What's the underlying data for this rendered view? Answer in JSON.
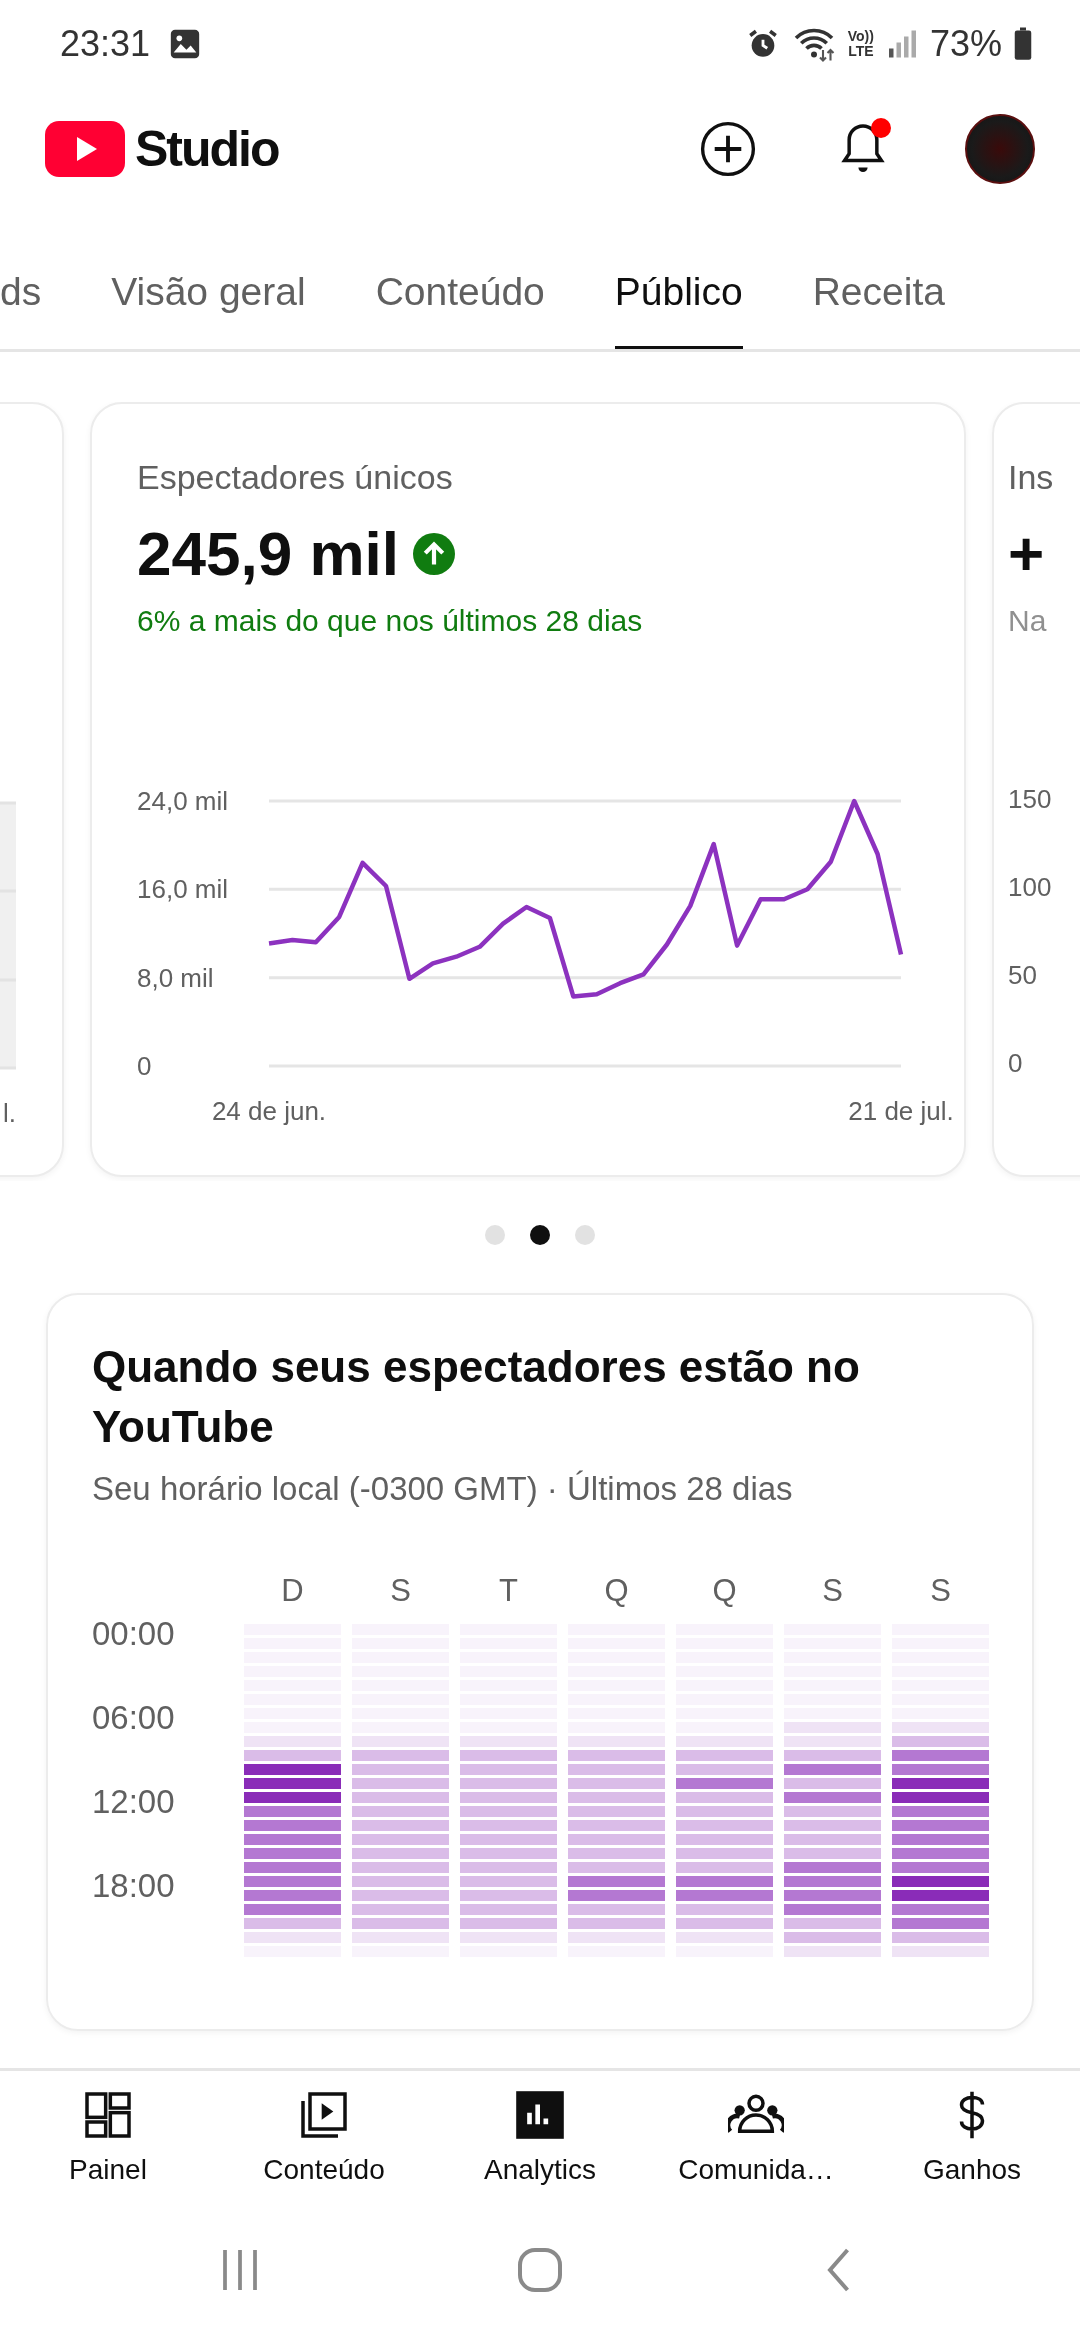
{
  "status_bar": {
    "time": "23:31",
    "network_label": [
      "Vo))",
      "LTE"
    ],
    "battery": "73%"
  },
  "header": {
    "title": "Studio",
    "notification_badge": true
  },
  "tabs": [
    {
      "label": "ds",
      "selected": false
    },
    {
      "label": "Visão geral",
      "selected": false
    },
    {
      "label": "Conteúdo",
      "selected": false
    },
    {
      "label": "Público",
      "selected": true
    },
    {
      "label": "Receita",
      "selected": false
    }
  ],
  "cards": [
    {
      "kind": "partial_left",
      "x_label": "l."
    },
    {
      "kind": "metric",
      "title": "Espectadores únicos",
      "value": "245,9 mil",
      "rising": true,
      "change": "6% a mais do que nos últimos 28 dias",
      "chart_data": {
        "type": "line",
        "ylim": [
          0,
          24
        ],
        "yticks": [
          {
            "value": 0,
            "label": "0"
          },
          {
            "value": 8,
            "label": "8,0 mil"
          },
          {
            "value": 16,
            "label": "16,0 mil"
          },
          {
            "value": 24,
            "label": "24,0 mil"
          }
        ],
        "categories": [
          "24 de jun.",
          null,
          null,
          null,
          null,
          null,
          null,
          null,
          null,
          null,
          null,
          null,
          null,
          null,
          null,
          null,
          null,
          null,
          null,
          null,
          null,
          null,
          null,
          null,
          null,
          null,
          null,
          "21 de jul."
        ],
        "series": [
          {
            "color": "#8c32bf",
            "values": [
              11.1,
              11.4,
              11.2,
              13.5,
              18.4,
              16.3,
              7.9,
              9.3,
              9.9,
              10.8,
              12.9,
              14.4,
              13.4,
              6.3,
              6.5,
              7.5,
              8.3,
              11.0,
              14.5,
              20.1,
              10.9,
              15.1,
              15.1,
              16.0,
              18.5,
              24.0,
              19.2,
              10.1
            ]
          }
        ]
      }
    },
    {
      "kind": "partial_right",
      "title": "Ins",
      "value": "+",
      "subtitle": "Na",
      "yticks": [
        "150",
        "100",
        "50",
        "0"
      ]
    }
  ],
  "pages": [
    {
      "selected": false
    },
    {
      "selected": true
    },
    {
      "selected": false
    }
  ],
  "heatmap_card": {
    "title": "Quando seus espectadores estão no YouTube",
    "subtitle": "Seu horário local (-0300 GMT) · Últimos 28 dias",
    "hour_labels": [
      "00:00",
      "06:00",
      "12:00",
      "18:00"
    ],
    "days": [
      {
        "label": "D",
        "hours": [
          {
            "color": "#f8f3fb"
          },
          {
            "color": "#f8f3fb"
          },
          {
            "color": "#f8f3fb"
          },
          {
            "color": "#f8f3fb"
          },
          {
            "color": "#f8f3fb"
          },
          {
            "color": "#f8f3fb"
          },
          {
            "color": "#f8f3fb"
          },
          {
            "color": "#f8f3fb"
          },
          {
            "color": "#efe3f5"
          },
          {
            "color": "#dabce8"
          },
          {
            "color": "#8a2cb8"
          },
          {
            "color": "#8a2cb8"
          },
          {
            "color": "#8a2cb8"
          },
          {
            "color": "#b478d2"
          },
          {
            "color": "#b478d2"
          },
          {
            "color": "#b478d2"
          },
          {
            "color": "#b478d2"
          },
          {
            "color": "#b478d2"
          },
          {
            "color": "#b478d2"
          },
          {
            "color": "#b478d2"
          },
          {
            "color": "#b478d2"
          },
          {
            "color": "#dabce8"
          },
          {
            "color": "#efe3f5"
          },
          {
            "color": "#f8f3fb"
          }
        ]
      },
      {
        "label": "S",
        "hours": [
          {
            "color": "#f8f3fb"
          },
          {
            "color": "#f8f3fb"
          },
          {
            "color": "#f8f3fb"
          },
          {
            "color": "#f8f3fb"
          },
          {
            "color": "#f8f3fb"
          },
          {
            "color": "#f8f3fb"
          },
          {
            "color": "#f8f3fb"
          },
          {
            "color": "#f8f3fb"
          },
          {
            "color": "#efe3f5"
          },
          {
            "color": "#dabce8"
          },
          {
            "color": "#dabce8"
          },
          {
            "color": "#dabce8"
          },
          {
            "color": "#dabce8"
          },
          {
            "color": "#dabce8"
          },
          {
            "color": "#dabce8"
          },
          {
            "color": "#dabce8"
          },
          {
            "color": "#dabce8"
          },
          {
            "color": "#dabce8"
          },
          {
            "color": "#dabce8"
          },
          {
            "color": "#dabce8"
          },
          {
            "color": "#dabce8"
          },
          {
            "color": "#dabce8"
          },
          {
            "color": "#efe3f5"
          },
          {
            "color": "#f8f3fb"
          }
        ]
      },
      {
        "label": "T",
        "hours": [
          {
            "color": "#f8f3fb"
          },
          {
            "color": "#f8f3fb"
          },
          {
            "color": "#f8f3fb"
          },
          {
            "color": "#f8f3fb"
          },
          {
            "color": "#f8f3fb"
          },
          {
            "color": "#f8f3fb"
          },
          {
            "color": "#f8f3fb"
          },
          {
            "color": "#f8f3fb"
          },
          {
            "color": "#efe3f5"
          },
          {
            "color": "#dabce8"
          },
          {
            "color": "#dabce8"
          },
          {
            "color": "#dabce8"
          },
          {
            "color": "#dabce8"
          },
          {
            "color": "#dabce8"
          },
          {
            "color": "#dabce8"
          },
          {
            "color": "#dabce8"
          },
          {
            "color": "#dabce8"
          },
          {
            "color": "#dabce8"
          },
          {
            "color": "#dabce8"
          },
          {
            "color": "#dabce8"
          },
          {
            "color": "#dabce8"
          },
          {
            "color": "#dabce8"
          },
          {
            "color": "#efe3f5"
          },
          {
            "color": "#f8f3fb"
          }
        ]
      },
      {
        "label": "Q",
        "hours": [
          {
            "color": "#f8f3fb"
          },
          {
            "color": "#f8f3fb"
          },
          {
            "color": "#f8f3fb"
          },
          {
            "color": "#f8f3fb"
          },
          {
            "color": "#f8f3fb"
          },
          {
            "color": "#f8f3fb"
          },
          {
            "color": "#f8f3fb"
          },
          {
            "color": "#f8f3fb"
          },
          {
            "color": "#efe3f5"
          },
          {
            "color": "#dabce8"
          },
          {
            "color": "#dabce8"
          },
          {
            "color": "#dabce8"
          },
          {
            "color": "#dabce8"
          },
          {
            "color": "#dabce8"
          },
          {
            "color": "#dabce8"
          },
          {
            "color": "#dabce8"
          },
          {
            "color": "#dabce8"
          },
          {
            "color": "#dabce8"
          },
          {
            "color": "#b478d2"
          },
          {
            "color": "#b478d2"
          },
          {
            "color": "#dabce8"
          },
          {
            "color": "#dabce8"
          },
          {
            "color": "#efe3f5"
          },
          {
            "color": "#f8f3fb"
          }
        ]
      },
      {
        "label": "Q",
        "hours": [
          {
            "color": "#f8f3fb"
          },
          {
            "color": "#f8f3fb"
          },
          {
            "color": "#f8f3fb"
          },
          {
            "color": "#f8f3fb"
          },
          {
            "color": "#f8f3fb"
          },
          {
            "color": "#f8f3fb"
          },
          {
            "color": "#f8f3fb"
          },
          {
            "color": "#f8f3fb"
          },
          {
            "color": "#efe3f5"
          },
          {
            "color": "#dabce8"
          },
          {
            "color": "#dabce8"
          },
          {
            "color": "#b478d2"
          },
          {
            "color": "#dabce8"
          },
          {
            "color": "#dabce8"
          },
          {
            "color": "#dabce8"
          },
          {
            "color": "#dabce8"
          },
          {
            "color": "#dabce8"
          },
          {
            "color": "#dabce8"
          },
          {
            "color": "#b478d2"
          },
          {
            "color": "#b478d2"
          },
          {
            "color": "#dabce8"
          },
          {
            "color": "#dabce8"
          },
          {
            "color": "#efe3f5"
          },
          {
            "color": "#f8f3fb"
          }
        ]
      },
      {
        "label": "S",
        "hours": [
          {
            "color": "#f8f3fb"
          },
          {
            "color": "#f8f3fb"
          },
          {
            "color": "#f8f3fb"
          },
          {
            "color": "#f8f3fb"
          },
          {
            "color": "#f8f3fb"
          },
          {
            "color": "#f8f3fb"
          },
          {
            "color": "#f8f3fb"
          },
          {
            "color": "#efe3f5"
          },
          {
            "color": "#efe3f5"
          },
          {
            "color": "#dabce8"
          },
          {
            "color": "#b478d2"
          },
          {
            "color": "#dabce8"
          },
          {
            "color": "#b478d2"
          },
          {
            "color": "#dabce8"
          },
          {
            "color": "#dabce8"
          },
          {
            "color": "#dabce8"
          },
          {
            "color": "#dabce8"
          },
          {
            "color": "#b478d2"
          },
          {
            "color": "#b478d2"
          },
          {
            "color": "#b478d2"
          },
          {
            "color": "#b478d2"
          },
          {
            "color": "#dabce8"
          },
          {
            "color": "#dabce8"
          },
          {
            "color": "#efe3f5"
          }
        ]
      },
      {
        "label": "S",
        "hours": [
          {
            "color": "#f8f3fb"
          },
          {
            "color": "#f8f3fb"
          },
          {
            "color": "#f8f3fb"
          },
          {
            "color": "#f8f3fb"
          },
          {
            "color": "#f8f3fb"
          },
          {
            "color": "#f8f3fb"
          },
          {
            "color": "#f8f3fb"
          },
          {
            "color": "#efe3f5"
          },
          {
            "color": "#dabce8"
          },
          {
            "color": "#b478d2"
          },
          {
            "color": "#b478d2"
          },
          {
            "color": "#8a2cb8"
          },
          {
            "color": "#8a2cb8"
          },
          {
            "color": "#b478d2"
          },
          {
            "color": "#b478d2"
          },
          {
            "color": "#b478d2"
          },
          {
            "color": "#b478d2"
          },
          {
            "color": "#b478d2"
          },
          {
            "color": "#8a2cb8"
          },
          {
            "color": "#8a2cb8"
          },
          {
            "color": "#b478d2"
          },
          {
            "color": "#b478d2"
          },
          {
            "color": "#dabce8"
          },
          {
            "color": "#efe3f5"
          }
        ]
      }
    ]
  },
  "bottom_nav": [
    {
      "label": "Painel",
      "selected": false
    },
    {
      "label": "Conteúdo",
      "selected": false
    },
    {
      "label": "Analytics",
      "selected": true
    },
    {
      "label": "Comunida…",
      "selected": false
    },
    {
      "label": "Ganhos",
      "selected": false
    }
  ]
}
